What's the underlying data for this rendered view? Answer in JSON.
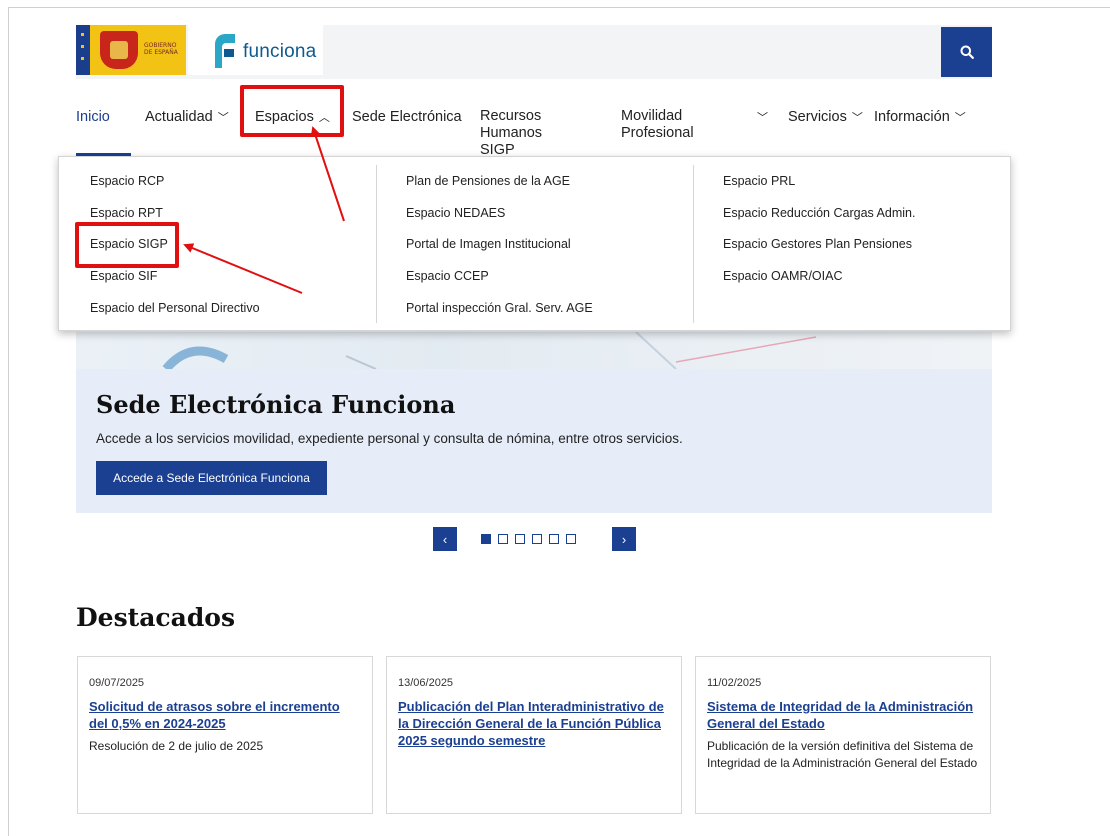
{
  "header": {
    "gov_logo_text": [
      "GOBIERNO",
      "DE ESPAÑA"
    ],
    "brand_name": "funciona",
    "search_icon": "search-icon"
  },
  "nav": {
    "items": [
      {
        "label": "Inicio",
        "active": true
      },
      {
        "label": "Actualidad",
        "chevron": "down"
      },
      {
        "label": "Espacios",
        "chevron": "up"
      },
      {
        "label": "Sede Electrónica"
      },
      {
        "label": "Recursos Humanos SIGP"
      },
      {
        "label": "Movilidad Profesional"
      },
      {
        "label": "",
        "chevron": "down"
      },
      {
        "label": "Servicios",
        "chevron": "down"
      },
      {
        "label": "Información",
        "chevron": "down"
      }
    ]
  },
  "menu": {
    "columns": [
      [
        "Espacio RCP",
        "Espacio RPT",
        "Espacio SIGP",
        "Espacio SIF",
        "Espacio del Personal Directivo"
      ],
      [
        "Plan de Pensiones de la AGE",
        "Espacio NEDAES",
        "Portal de Imagen Institucional",
        "Espacio CCEP",
        "Portal inspección Gral. Serv. AGE"
      ],
      [
        "Espacio PRL",
        "Espacio Reducción Cargas Admin.",
        "Espacio Gestores Plan Pensiones",
        "Espacio OAMR/OIAC"
      ]
    ]
  },
  "hero": {
    "title": "Sede Electrónica Funciona",
    "subtitle": "Accede a los servicios movilidad, expediente personal y consulta de nómina, entre otros servicios.",
    "button": "Accede a Sede Electrónica Funciona"
  },
  "carousel": {
    "prev": "‹",
    "next": "›",
    "slides": 6,
    "active_index": 0
  },
  "featured": {
    "title": "Destacados",
    "cards": [
      {
        "date": "09/07/2025",
        "title": "Solicitud de atrasos sobre el incremento del 0,5% en 2024-2025",
        "desc": "Resolución de 2 de julio de 2025"
      },
      {
        "date": "13/06/2025",
        "title": "Publicación del Plan Interadministrativo de la Dirección General de la Función Pública 2025 segundo semestre",
        "desc": ""
      },
      {
        "date": "11/02/2025",
        "title": "Sistema de Integridad de la Administración General del Estado",
        "desc": "Publicación de la versión definitiva del Sistema de Integridad de la Administración General del Estado"
      }
    ]
  },
  "colors": {
    "primary": "#1b3f91",
    "annotation": "#e01010",
    "hero_bg": "#e6edf8"
  }
}
